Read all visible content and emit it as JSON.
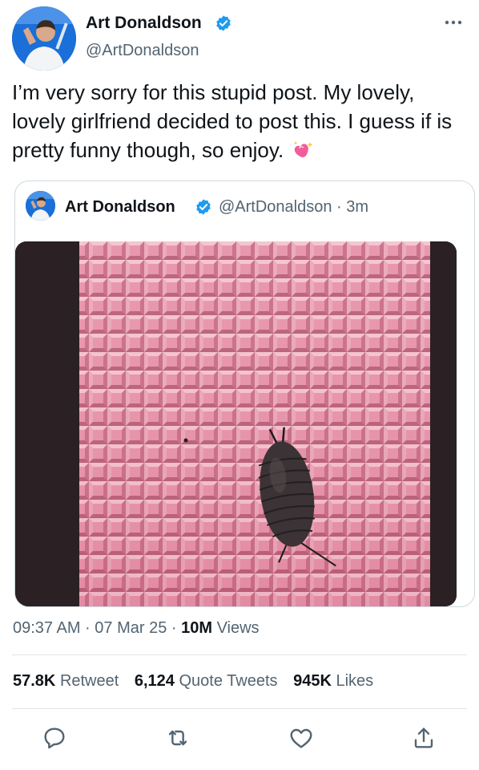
{
  "author": {
    "name": "Art Donaldson",
    "handle": "@ArtDonaldson"
  },
  "tweet": {
    "text": "I’m very sorry for this stupid post. My lovely, lovely girlfriend decided to post this. I guess if is pretty funny though, so enjoy."
  },
  "quoted": {
    "name": "Art Donaldson",
    "meta": "@ArtDonaldson · 3m"
  },
  "timestamp": {
    "time_date": "09:37 AM · 07 Mar 25 · ",
    "views_count": "10M",
    "views_label": " Views"
  },
  "stats": {
    "retweets_count": "57.8K",
    "retweets_label": "Retweet",
    "quotes_count": "6,124",
    "quotes_label": "Quote Tweets",
    "likes_count": "945K",
    "likes_label": "Likes"
  },
  "icons": {
    "verified": "verified-badge-icon",
    "more": "more-icon",
    "heart_emoji": "sparkling-heart-icon",
    "reply": "reply-icon",
    "retweet": "retweet-icon",
    "like": "like-icon",
    "share": "share-icon"
  },
  "colors": {
    "verified": "#1d9bf0",
    "secondary_text": "#536471",
    "primary_text": "#0f1419",
    "tile_pink": "#e58fa6"
  }
}
